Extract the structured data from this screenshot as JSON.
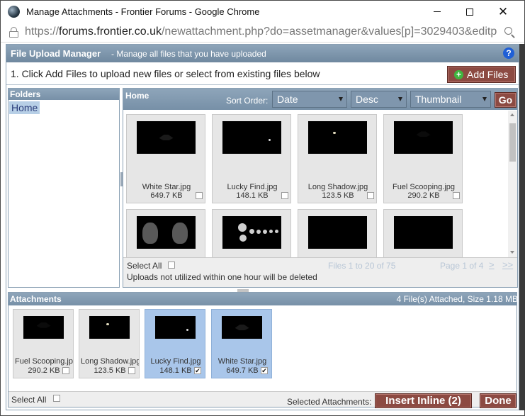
{
  "window": {
    "title": "Manage Attachments - Frontier Forums - Google Chrome",
    "url_scheme": "https://",
    "url_host": "forums.frontier.co.uk",
    "url_path": "/newattachment.php?do=assetmanager&values[p]=3029403&editp"
  },
  "header": {
    "title": "File Upload Manager",
    "subtitle": "- Manage all files that you have uploaded",
    "help": "?"
  },
  "instructions": {
    "text": "1. Click Add Files to upload new files or select from existing files below",
    "add_files_label": "Add Files"
  },
  "folders": {
    "heading": "Folders",
    "items": [
      {
        "label": "Home"
      }
    ]
  },
  "files": {
    "folder_label": "Home",
    "sort_label": "Sort Order:",
    "sort_value": "Date",
    "dir_value": "Desc",
    "view_value": "Thumbnail",
    "go_label": "Go",
    "tiles": [
      {
        "name": "White Star.jpg",
        "size": "649.7 KB",
        "art": "white"
      },
      {
        "name": "Lucky Find.jpg",
        "size": "148.1 KB",
        "art": "lucky"
      },
      {
        "name": "Long Shadow.jpg",
        "size": "123.5 KB",
        "art": "long"
      },
      {
        "name": "Fuel Scooping.jpg",
        "size": "290.2 KB",
        "art": "fuel"
      },
      {
        "name": "",
        "size": "",
        "art": "faces"
      },
      {
        "name": "",
        "size": "",
        "art": "dots"
      },
      {
        "name": "",
        "size": "",
        "art": "planet"
      },
      {
        "name": "",
        "size": "",
        "art": "dark"
      }
    ],
    "select_all": "Select All",
    "note": "Uploads not utilized within one hour will be deleted",
    "page_info": "Files 1 to 20 of 75",
    "page_of": "Page 1 of 4",
    "next": ">",
    "last": ">>"
  },
  "attachments": {
    "heading": "Attachments",
    "info": "4 File(s) Attached, Size 1.18 MB",
    "tiles": [
      {
        "name": "Fuel Scooping.jpg",
        "size": "290.2 KB",
        "art": "fuel",
        "selected": false,
        "checked": false
      },
      {
        "name": "Long Shadow.jpg",
        "size": "123.5 KB",
        "art": "long",
        "selected": false,
        "checked": false
      },
      {
        "name": "Lucky Find.jpg",
        "size": "148.1 KB",
        "art": "lucky",
        "selected": true,
        "checked": true
      },
      {
        "name": "White Star.jpg",
        "size": "649.7 KB",
        "art": "white",
        "selected": true,
        "checked": true
      }
    ],
    "select_all": "Select All",
    "selected_label": "Selected Attachments:",
    "insert_inline_label": "Insert Inline (2)",
    "done_label": "Done"
  }
}
